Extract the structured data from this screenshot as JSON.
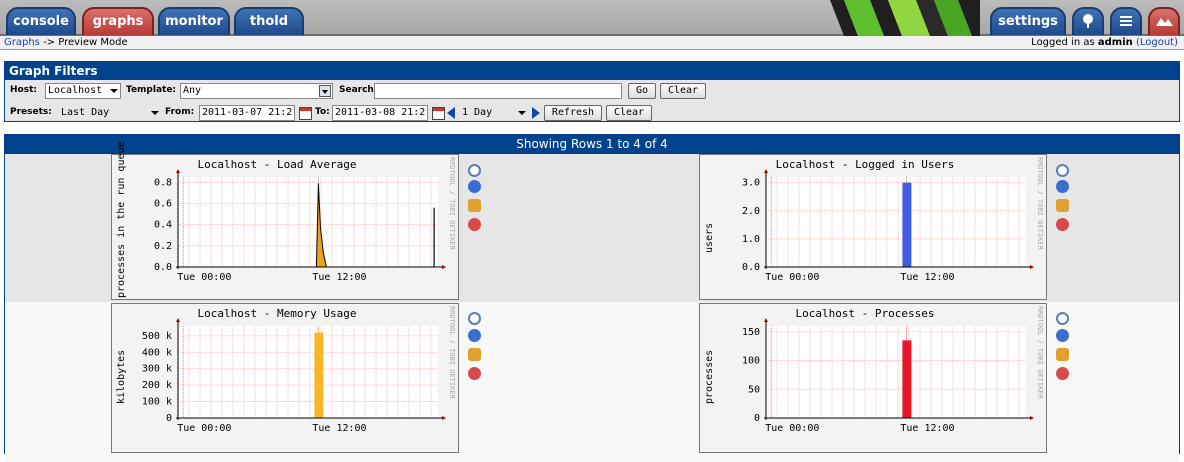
{
  "tabs": {
    "console": "console",
    "graphs": "graphs",
    "monitor": "monitor",
    "thold": "thold",
    "settings": "settings"
  },
  "icon_tabs": [
    "tree-icon",
    "list-icon",
    "preview-icon"
  ],
  "nav": {
    "breadcrumb_link": "Graphs",
    "breadcrumb_rest": "-> Preview Mode",
    "logged_in_prefix": "Logged in as",
    "user": "admin",
    "logout": "(Logout)"
  },
  "filters": {
    "title": "Graph Filters",
    "host_label": "Host:",
    "host_value": "Localhost",
    "template_label": "Template:",
    "template_value": "Any",
    "search_label": "Search:",
    "search_value": "",
    "go": "Go",
    "clear": "Clear",
    "presets_label": "Presets:",
    "presets_value": "Last Day",
    "from_label": "From:",
    "from_value": "2011-03-07 21:2",
    "to_label": "To:",
    "to_value": "2011-03-08 21:2",
    "span_value": "1 Day",
    "refresh": "Refresh",
    "clear2": "Clear"
  },
  "results": {
    "header": "Showing Rows 1 to 4 of 4"
  },
  "graph_side_text": "RRDTOOL / TOBI OETIKER",
  "colors": {
    "header_blue": "#00438c",
    "tab_blue": "#2a5ea8",
    "tab_red": "#c0504d",
    "load_fill": "#f0a020",
    "users_bar": "#3d5ee0",
    "memory_bar": "#f5b727",
    "processes_bar": "#e8182a"
  },
  "chart_data": [
    {
      "type": "area",
      "title": "Localhost - Load Average",
      "ylabel": "processes in the run queue",
      "xlabel": "",
      "x_ticks": [
        "Tue 00:00",
        "Tue 12:00"
      ],
      "y_ticks": [
        "0.0",
        "0.2",
        "0.4",
        "0.6",
        "0.8"
      ],
      "ylim": [
        0,
        0.85
      ],
      "spikes": [
        {
          "x_frac": 0.54,
          "value": 0.79
        },
        {
          "x_frac": 0.985,
          "value": 0.56
        }
      ],
      "grid": true
    },
    {
      "type": "bar",
      "title": "Localhost - Logged in Users",
      "ylabel": "users",
      "xlabel": "",
      "x_ticks": [
        "Tue 00:00",
        "Tue 12:00"
      ],
      "y_ticks": [
        "0.0",
        "1.0",
        "2.0",
        "3.0"
      ],
      "ylim": [
        0,
        3.2
      ],
      "bars": [
        {
          "x_frac": 0.54,
          "value": 3.0
        }
      ],
      "grid": true
    },
    {
      "type": "bar",
      "title": "Localhost - Memory Usage",
      "ylabel": "kilobytes",
      "xlabel": "",
      "x_ticks": [
        "Tue 00:00",
        "Tue 12:00"
      ],
      "y_ticks": [
        "0",
        "100 k",
        "200 k",
        "300 k",
        "400 k",
        "500 k"
      ],
      "ylim": [
        0,
        560
      ],
      "bars": [
        {
          "x_frac": 0.54,
          "value": 520
        }
      ],
      "grid": true
    },
    {
      "type": "bar",
      "title": "Localhost - Processes",
      "ylabel": "processes",
      "xlabel": "",
      "x_ticks": [
        "Tue 00:00",
        "Tue 12:00"
      ],
      "y_ticks": [
        "0",
        "50",
        "100",
        "150"
      ],
      "ylim": [
        0,
        160
      ],
      "bars": [
        {
          "x_frac": 0.54,
          "value": 135
        }
      ],
      "grid": true
    }
  ]
}
